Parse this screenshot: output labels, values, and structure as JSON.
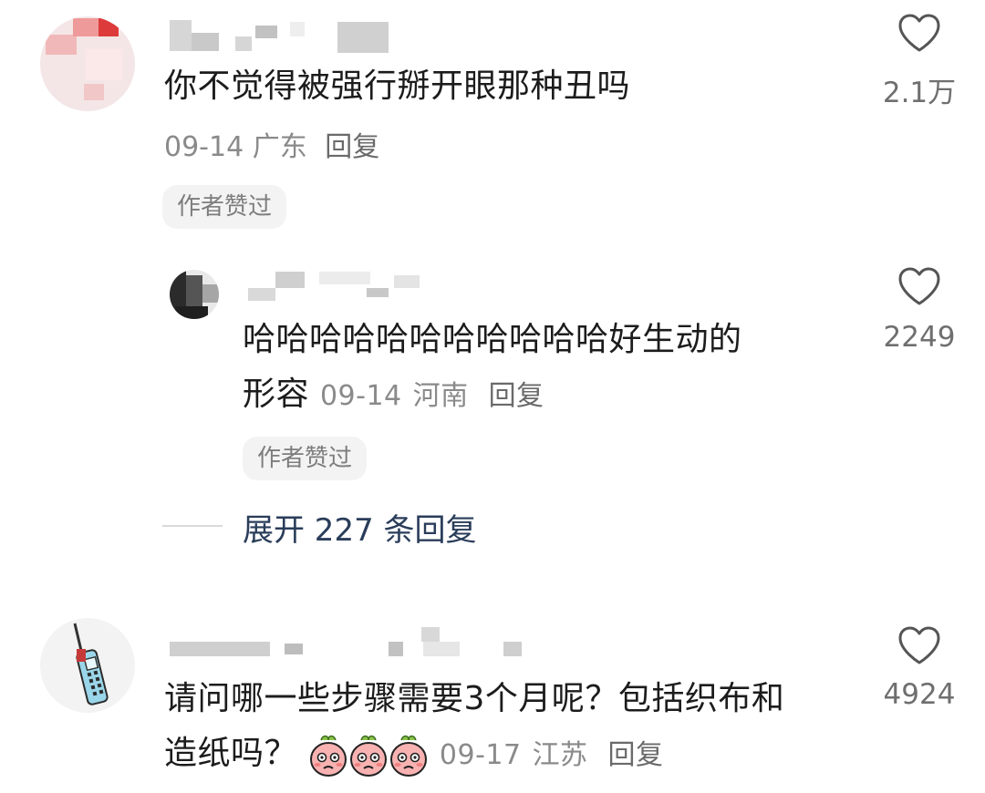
{
  "comments": [
    {
      "username": "",
      "text": "你不觉得被强行掰开眼那种丑吗",
      "date": "09-14",
      "location": "广东",
      "reply_label": "回复",
      "badge": "作者赞过",
      "likes": "2.1万"
    },
    {
      "username": "",
      "text_line1": "哈哈哈哈哈哈哈哈哈哈哈好生动的",
      "text_line2": "形容",
      "date": "09-14",
      "location": "河南",
      "reply_label": "回复",
      "badge": "作者赞过",
      "likes": "2249"
    },
    {
      "username": "",
      "text_line1": "请问哪一些步骤需要3个月呢？包括织布和",
      "text_line2": "造纸吗？",
      "emoji_icons": [
        "crying-peach-emoji",
        "crying-peach-emoji",
        "crying-peach-emoji"
      ],
      "date": "09-17",
      "location": "江苏",
      "reply_label": "回复",
      "likes": "4924"
    }
  ],
  "expand_replies": "展开 227 条回复",
  "icons": {
    "like": "heart-outline-icon"
  },
  "colors": {
    "accent_link": "#2a3d5a",
    "meta_gray": "#8a8a8a"
  }
}
